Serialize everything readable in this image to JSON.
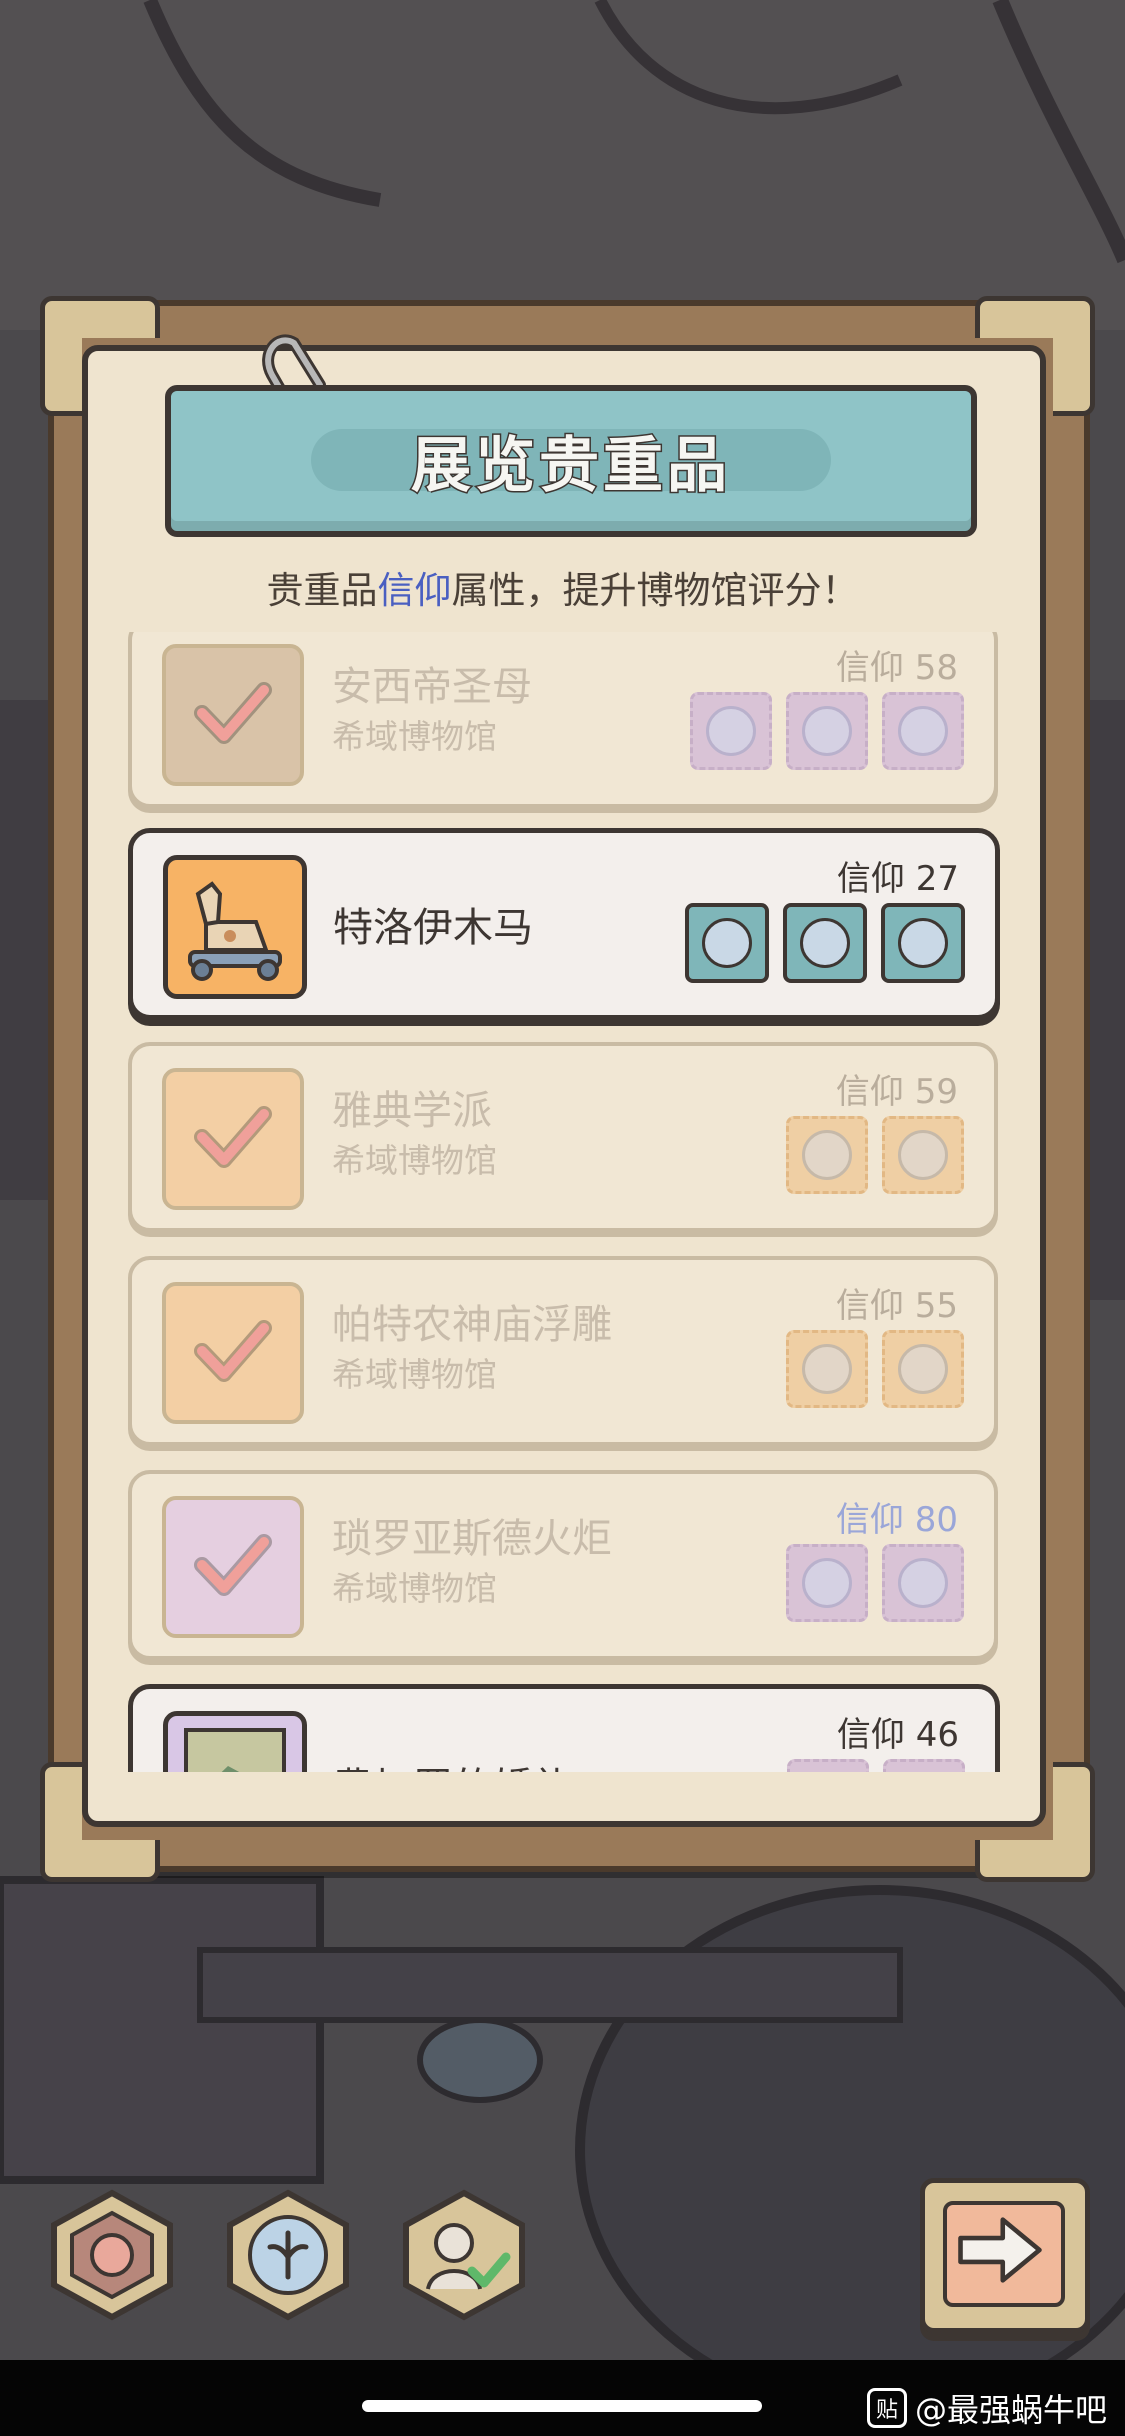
{
  "screen": {
    "title": "展览贵重品",
    "subtitle_prefix": "贵重品",
    "subtitle_highlight": "信仰",
    "subtitle_suffix": "属性，提升博物馆评分！"
  },
  "exhibits": [
    {
      "name": "安西帝圣母",
      "museum": "希域博物馆",
      "faith": "信仰 58",
      "badges": 3,
      "badge_color": "purple",
      "state": "exhibited"
    },
    {
      "name": "特洛伊木马",
      "museum": "",
      "faith": "信仰 27",
      "badges": 3,
      "badge_color": "teal",
      "state": "selected"
    },
    {
      "name": "雅典学派",
      "museum": "希域博物馆",
      "faith": "信仰 59",
      "badges": 2,
      "badge_color": "orange",
      "state": "exhibited"
    },
    {
      "name": "帕特农神庙浮雕",
      "museum": "希域博物馆",
      "faith": "信仰 55",
      "badges": 2,
      "badge_color": "orange",
      "state": "exhibited"
    },
    {
      "name": "琐罗亚斯德火炬",
      "museum": "希域博物馆",
      "faith": "信仰 80",
      "badges": 2,
      "badge_color": "purple",
      "state": "exhibited"
    },
    {
      "name": "费加罗的婚礼",
      "museum": "",
      "faith": "信仰 46",
      "badges": 2,
      "badge_color": "purple",
      "state": "available"
    }
  ],
  "bottom_buttons": {
    "left_icons": [
      "rose-emblem-icon",
      "faith-emblem-icon",
      "curator-approve-icon"
    ],
    "next_icon": "arrow-right-icon"
  },
  "watermark": {
    "icon": "贴",
    "text": "@最强蜗牛吧"
  },
  "colors": {
    "banner": "#8fc4c7",
    "paper": "#efe4cf",
    "outline": "#3d3632",
    "faith_highlight": "#4a5fc1",
    "selected_badge": "#7fb6b9"
  }
}
